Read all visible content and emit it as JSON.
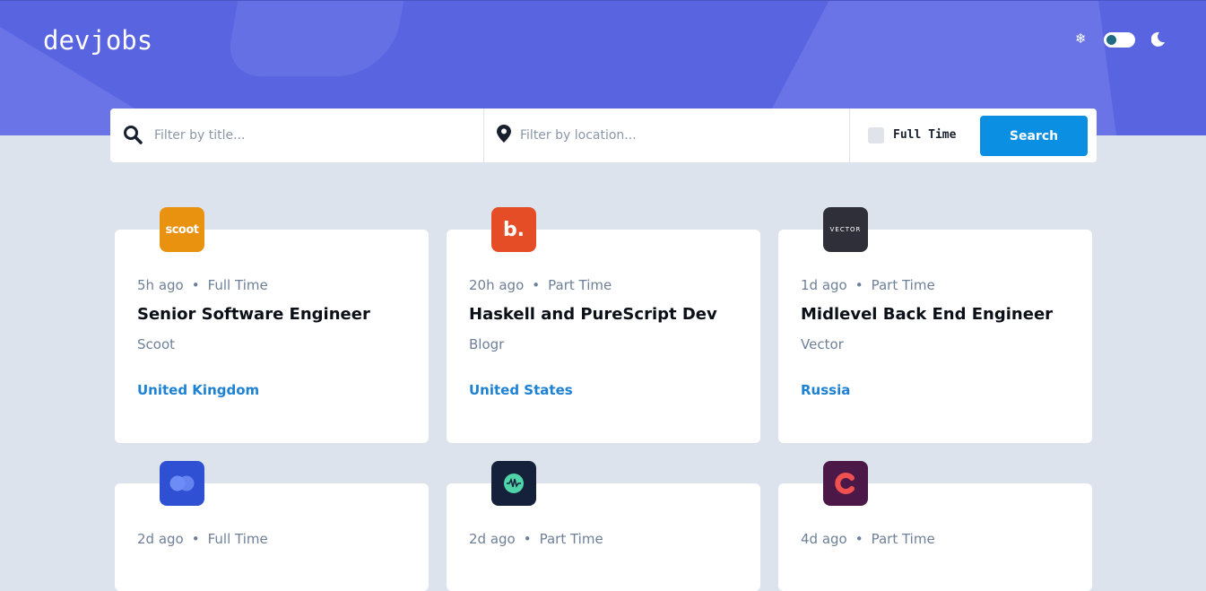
{
  "app": {
    "logo": "devjobs"
  },
  "theme": {
    "light_icon": "sun-icon",
    "dark_icon": "moon-icon",
    "toggle_state": "light"
  },
  "search": {
    "title_placeholder": "Filter by title...",
    "location_placeholder": "Filter by location...",
    "fulltime_label": "Full Time",
    "fulltime_checked": false,
    "button_label": "Search"
  },
  "colors": {
    "brand": "#5964e0",
    "accent": "#0b8fe3",
    "location": "#1d81d4"
  },
  "jobs": [
    {
      "logo_text": "scoot",
      "logo_color": "#e99210",
      "posted": "5h ago",
      "dot": "•",
      "contract": "Full Time",
      "position": "Senior Software Engineer",
      "company": "Scoot",
      "location": "United Kingdom"
    },
    {
      "logo_text": "b.",
      "logo_color": "#e54d26",
      "posted": "20h ago",
      "dot": "•",
      "contract": "Part Time",
      "position": "Haskell and PureScript Dev",
      "company": "Blogr",
      "location": "United States"
    },
    {
      "logo_text": "VECTOR",
      "logo_color": "#2f2f3a",
      "posted": "1d ago",
      "dot": "•",
      "contract": "Part Time",
      "position": "Midlevel Back End Engineer",
      "company": "Vector",
      "location": "Russia"
    },
    {
      "logo_text": "",
      "logo_icon": "overlapping-circles-icon",
      "logo_color": "#3050d4",
      "posted": "2d ago",
      "dot": "•",
      "contract": "Full Time",
      "position": "",
      "company": "",
      "location": ""
    },
    {
      "logo_text": "",
      "logo_icon": "waveform-icon",
      "logo_color": "#15213a",
      "posted": "2d ago",
      "dot": "•",
      "contract": "Part Time",
      "position": "",
      "company": "",
      "location": ""
    },
    {
      "logo_text": "",
      "logo_icon": "c-letter-icon",
      "logo_color": "#4b1848",
      "posted": "4d ago",
      "dot": "•",
      "contract": "Part Time",
      "position": "",
      "company": "",
      "location": ""
    }
  ]
}
